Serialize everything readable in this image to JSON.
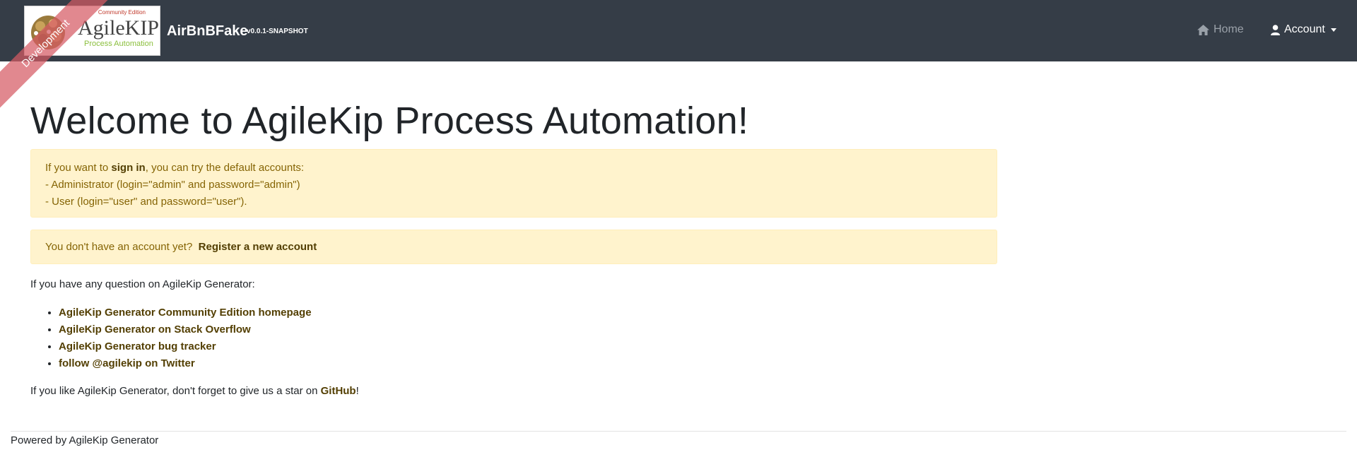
{
  "navbar": {
    "logo": {
      "edition": "Community Edition",
      "name": "AgileKIP",
      "subtitle": "Process Automation"
    },
    "ribbon": "Development",
    "brand_title": "AirBnBFake",
    "brand_version": "v0.0.1-SNAPSHOT",
    "home_label": "Home",
    "account_label": "Account",
    "home_icon": "home-icon",
    "account_icon": "user-icon"
  },
  "main": {
    "title": "Welcome to AgileKip Process Automation!",
    "signin_alert": {
      "prefix": "If you want to ",
      "signin": "sign in",
      "suffix": ", you can try the default accounts:",
      "line_admin": "- Administrator (login=\"admin\" and password=\"admin\")",
      "line_user": "- User (login=\"user\" and password=\"user\")."
    },
    "register_alert": {
      "text": "You don't have an account yet?",
      "link": "Register a new account"
    },
    "question": "If you have any question on AgileKip Generator:",
    "links": [
      "AgileKip Generator Community Edition homepage",
      "AgileKip Generator on Stack Overflow",
      "AgileKip Generator bug tracker",
      "follow @agilekip on Twitter"
    ],
    "star": {
      "prefix": "If you like AgileKip Generator, don't forget to give us a star on ",
      "link": "GitHub",
      "suffix": "!"
    }
  },
  "footer": {
    "text": "Powered by AgileKip Generator"
  },
  "colors": {
    "navbar": "#353d47",
    "alert_bg": "#fff3cd",
    "alert_text": "#856404",
    "link": "#533f03",
    "ribbon": "#d65a64"
  }
}
